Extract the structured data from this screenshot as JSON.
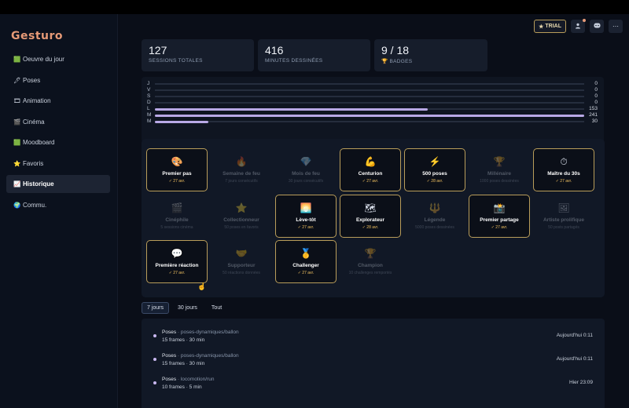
{
  "app": {
    "name": "Gesturo"
  },
  "header": {
    "trial_label": "TRIAL"
  },
  "sidebar": {
    "items": [
      {
        "icon": "🟩",
        "label": "Oeuvre du jour"
      },
      {
        "icon": "🖊",
        "label": "Poses"
      },
      {
        "icon": "🎞",
        "label": "Animation"
      },
      {
        "icon": "🎬",
        "label": "Cinéma"
      },
      {
        "icon": "🟩",
        "label": "Moodboard"
      },
      {
        "icon": "⭐",
        "label": "Favoris"
      },
      {
        "icon": "📈",
        "label": "Historique",
        "active": true
      },
      {
        "icon": "🌍",
        "label": "Commu."
      }
    ]
  },
  "stats": [
    {
      "value": "127",
      "label": "SESSIONS TOTALES"
    },
    {
      "value": "416",
      "label": "MINUTES DESSINÉES"
    },
    {
      "value": "9 / 18",
      "label": "🏆 BADGES"
    }
  ],
  "weekly_chart": {
    "rows": [
      {
        "day": "J",
        "value": 0
      },
      {
        "day": "V",
        "value": 0
      },
      {
        "day": "S",
        "value": 0
      },
      {
        "day": "D",
        "value": 0
      },
      {
        "day": "L",
        "value": 153
      },
      {
        "day": "M",
        "value": 241
      },
      {
        "day": "M",
        "value": 30
      }
    ],
    "max": 241
  },
  "badges": [
    {
      "icon": "🎨",
      "name": "Premier pas",
      "sub": "✓ 27 avr.",
      "unlocked": true
    },
    {
      "icon": "🔥",
      "name": "Semaine de feu",
      "sub": "7 jours consécutifs",
      "unlocked": false
    },
    {
      "icon": "💎",
      "name": "Mois de feu",
      "sub": "30 jours consécutifs",
      "unlocked": false
    },
    {
      "icon": "💪",
      "name": "Centurion",
      "sub": "✓ 27 avr.",
      "unlocked": true
    },
    {
      "icon": "⚡",
      "name": "500 poses",
      "sub": "✓ 28 avr.",
      "unlocked": true
    },
    {
      "icon": "🏆",
      "name": "Millénaire",
      "sub": "1000 poses dessinées",
      "unlocked": false
    },
    {
      "icon": "⏱",
      "name": "Maître du 30s",
      "sub": "✓ 27 avr.",
      "unlocked": true
    },
    {
      "icon": "🎬",
      "name": "Cinéphile",
      "sub": "5 sessions cinéma",
      "unlocked": false
    },
    {
      "icon": "⭐",
      "name": "Collectionneur",
      "sub": "50 poses en favoris",
      "unlocked": false
    },
    {
      "icon": "🌅",
      "name": "Lève-tôt",
      "sub": "✓ 27 avr.",
      "unlocked": true
    },
    {
      "icon": "🗺",
      "name": "Explorateur",
      "sub": "✓ 28 avr.",
      "unlocked": true
    },
    {
      "icon": "🔱",
      "name": "Légende",
      "sub": "5000 poses dessinées",
      "unlocked": false
    },
    {
      "icon": "📸",
      "name": "Premier partage",
      "sub": "✓ 27 avr.",
      "unlocked": true
    },
    {
      "icon": "🖼",
      "name": "Artiste prolifique",
      "sub": "50 posts partagés",
      "unlocked": false
    },
    {
      "icon": "💬",
      "name": "Première réaction",
      "sub": "✓ 27 avr.",
      "unlocked": true
    },
    {
      "icon": "🤝",
      "name": "Supporteur",
      "sub": "50 réactions données",
      "unlocked": false
    },
    {
      "icon": "🥇",
      "name": "Challenger",
      "sub": "✓ 27 avr.",
      "unlocked": true
    },
    {
      "icon": "🏆",
      "name": "Champion",
      "sub": "10 challenges remportés",
      "unlocked": false
    }
  ],
  "range_tabs": [
    {
      "label": "7 jours",
      "active": true
    },
    {
      "label": "30 jours"
    },
    {
      "label": "Tout"
    }
  ],
  "sessions": [
    {
      "category": "Poses",
      "path": " · poses-dynamiques/ballon",
      "meta": "15 frames · 30 min",
      "time": "Aujourd'hui 0:11"
    },
    {
      "category": "Poses",
      "path": " · poses-dynamiques/ballon",
      "meta": "15 frames · 30 min",
      "time": "Aujourd'hui 0:11"
    },
    {
      "category": "Poses",
      "path": " · locomotion/run",
      "meta": "10 frames · 5 min",
      "time": "Hier 23:09"
    }
  ]
}
